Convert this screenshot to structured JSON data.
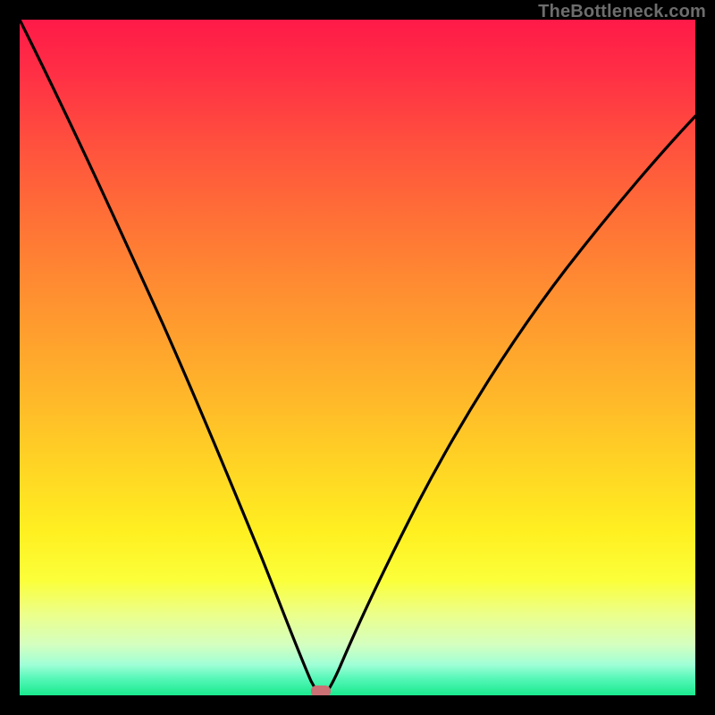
{
  "watermark": {
    "text": "TheBottleneck.com"
  },
  "colors": {
    "frame": "#000000",
    "curve_stroke": "#000000",
    "marker_fill": "#cb7074",
    "gradient_stops": [
      "#ff1a48",
      "#ff2f45",
      "#ff4f3e",
      "#ff7236",
      "#ff9330",
      "#ffb52a",
      "#ffd424",
      "#fff021",
      "#fbff3a",
      "#ecff8a",
      "#d4ffc0",
      "#9fffd6",
      "#56f7b8",
      "#19e98e"
    ]
  },
  "chart_data": {
    "type": "line",
    "title": "",
    "xlabel": "",
    "ylabel": "",
    "xlim": [
      0,
      1
    ],
    "ylim": [
      0,
      1
    ],
    "axes_visible": false,
    "grid": false,
    "notes": "V-shaped bottleneck curve over rainbow vertical gradient; minimum marked by small rounded marker near bottom.",
    "series": [
      {
        "name": "bottleneck-curve",
        "x": [
          0.0,
          0.05,
          0.1,
          0.15,
          0.2,
          0.25,
          0.3,
          0.35,
          0.39,
          0.41,
          0.428,
          0.444,
          0.46,
          0.5,
          0.55,
          0.62,
          0.7,
          0.78,
          0.86,
          0.93,
          1.0
        ],
        "y": [
          1.0,
          0.87,
          0.74,
          0.61,
          0.49,
          0.38,
          0.28,
          0.18,
          0.09,
          0.04,
          0.008,
          0.0,
          0.01,
          0.06,
          0.15,
          0.28,
          0.42,
          0.55,
          0.66,
          0.74,
          0.81
        ]
      }
    ],
    "marker": {
      "x": 0.444,
      "y": 0.0,
      "shape": "rounded-rect"
    }
  }
}
